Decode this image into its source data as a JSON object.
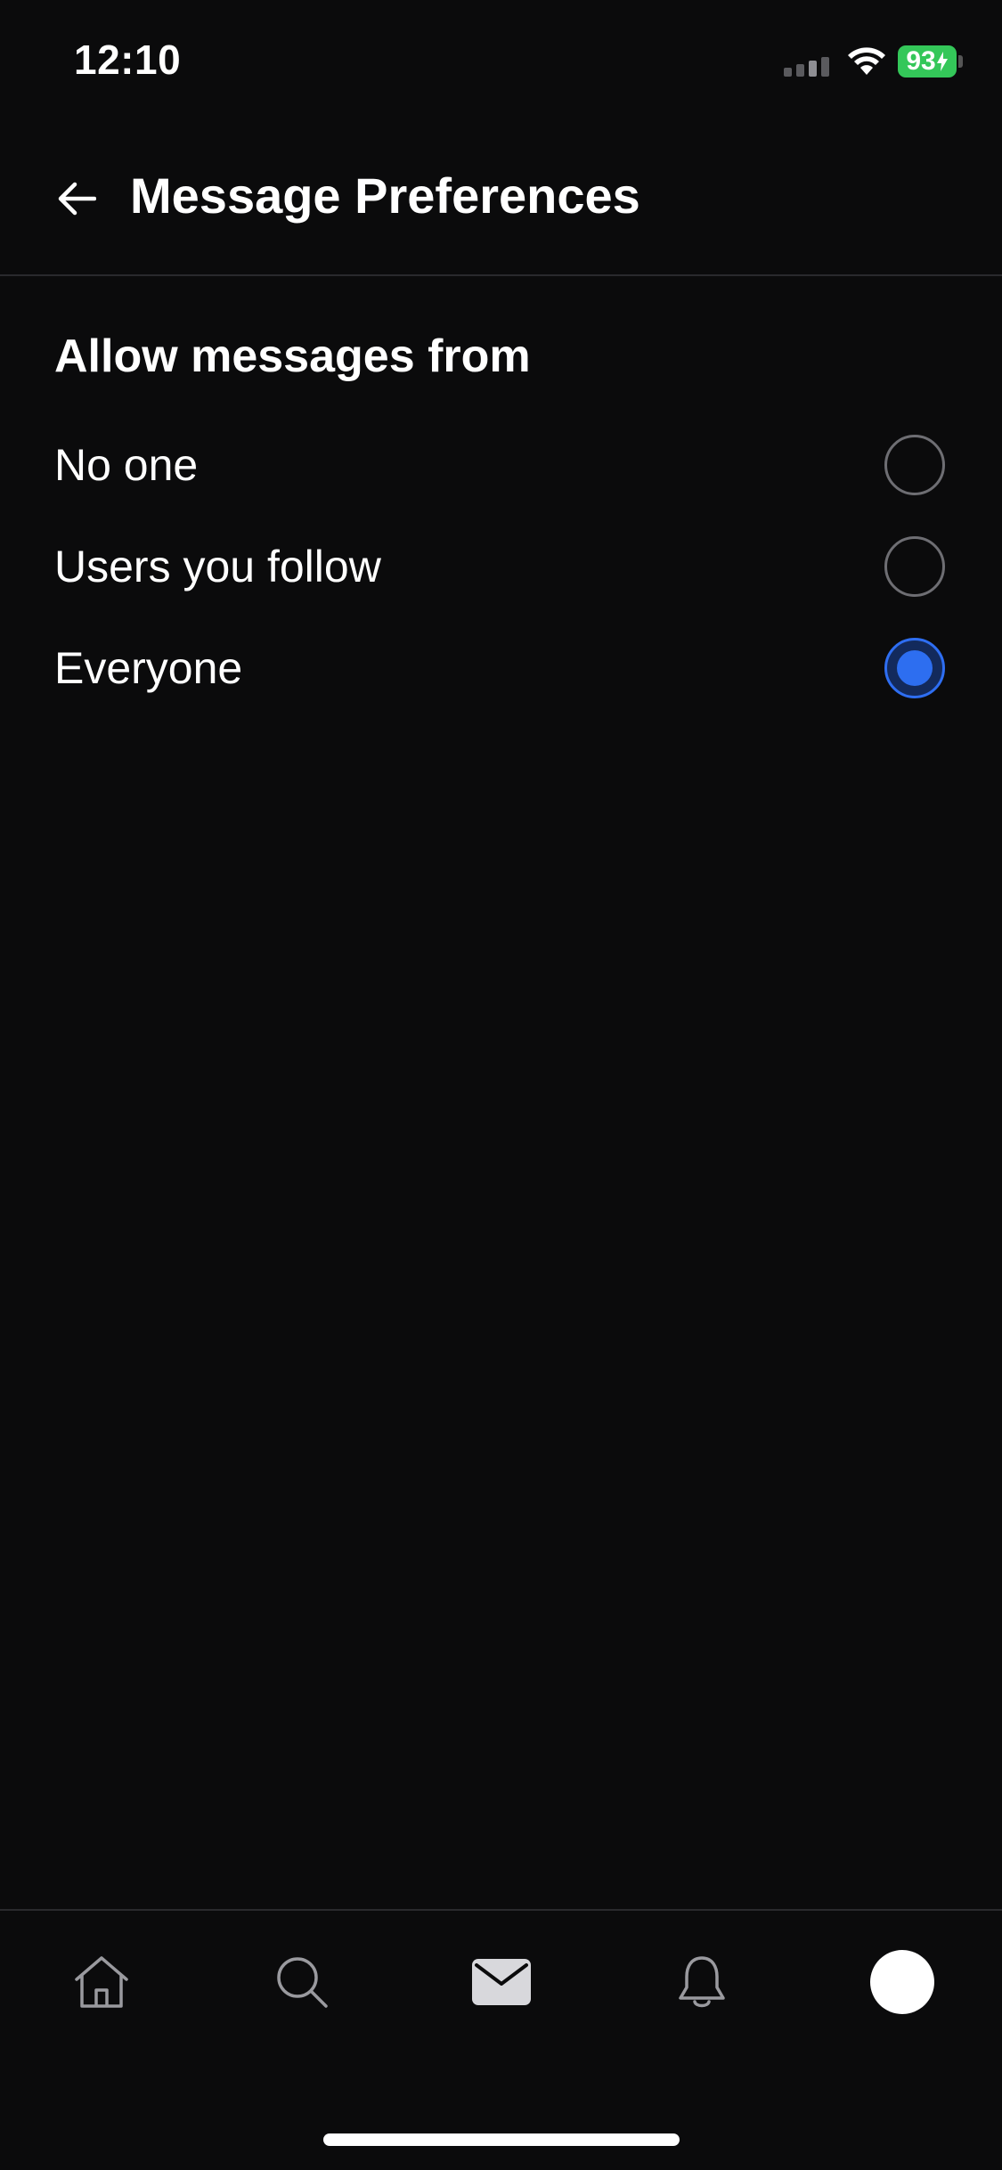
{
  "status_bar": {
    "time": "12:10",
    "battery_level": "93",
    "battery_color": "#34c759",
    "icons": [
      "signal-icon",
      "wifi-icon",
      "battery-icon"
    ]
  },
  "header": {
    "title": "Message Preferences",
    "back_icon": "arrow-left-icon"
  },
  "section": {
    "heading": "Allow messages from",
    "options": [
      {
        "label": "No one",
        "selected": false
      },
      {
        "label": "Users you follow",
        "selected": false
      },
      {
        "label": "Everyone",
        "selected": true
      }
    ],
    "accent_color": "#2d6ef0"
  },
  "tab_bar": {
    "tabs": [
      {
        "icon": "home-icon"
      },
      {
        "icon": "search-icon"
      },
      {
        "icon": "mail-icon",
        "active": true
      },
      {
        "icon": "bell-icon"
      },
      {
        "icon": "avatar"
      }
    ]
  }
}
